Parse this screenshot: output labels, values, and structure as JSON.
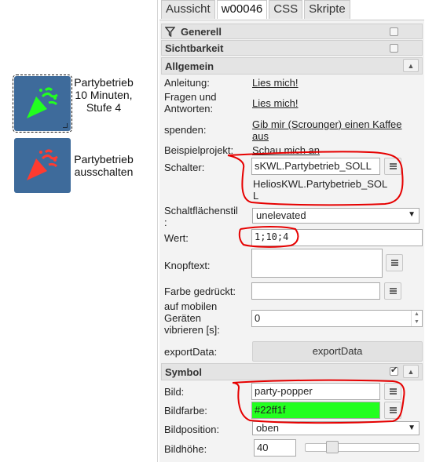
{
  "widgets": [
    {
      "label_lines": [
        "Partybetrieb",
        "10 Minuten,",
        "Stufe 4"
      ],
      "icon": "party-popper-icon",
      "icon_color": "#22ff1f",
      "selected": true
    },
    {
      "label_lines": [
        "Partybetrieb",
        "ausschalten"
      ],
      "icon": "party-popper-icon",
      "icon_color": "#ff3b30",
      "selected": false
    }
  ],
  "tabs": [
    "Aussicht",
    "w00046",
    "CSS",
    "Skripte"
  ],
  "groups": {
    "generell": "Generell",
    "sichtbarkeit": "Sichtbarkeit",
    "allgemein": "Allgemein",
    "symbol": "Symbol"
  },
  "fields": {
    "anleitung": {
      "label": "Anleitung:",
      "link": "Lies mich!"
    },
    "faq": {
      "label_lines": [
        "Fragen und",
        "Antworten:"
      ],
      "link": "Lies mich!"
    },
    "spenden": {
      "label": "spenden:",
      "link_lines": [
        "Gib mir (Scrounger) einen Kaffee",
        "aus"
      ]
    },
    "beispiel": {
      "label": "Beispielprojekt:",
      "link": "Schau mich an"
    },
    "schalter": {
      "label": "Schalter:",
      "value": "sKWL.Partybetrieb_SOLL",
      "oid_lines": [
        "HeliosKWL.Partybetrieb_SOL",
        "L"
      ]
    },
    "schaltflaechenstil": {
      "label_lines": [
        "Schaltflächenstil",
        ":"
      ],
      "value": "unelevated"
    },
    "wert": {
      "label": "Wert:",
      "value": "1;10;4"
    },
    "knopftext": {
      "label": "Knopftext:",
      "value": ""
    },
    "farbe_gedrueckt": {
      "label": "Farbe gedrückt:",
      "value": ""
    },
    "vibrieren": {
      "label_lines": [
        "auf mobilen",
        "Geräten",
        "vibrieren [s]:"
      ],
      "value": "0"
    },
    "exportdata": {
      "label": "exportData:",
      "button": "exportData"
    },
    "bild": {
      "label": "Bild:",
      "value": "party-popper"
    },
    "bildfarbe": {
      "label": "Bildfarbe:",
      "value": "#22ff1f",
      "color": "#22ff1f"
    },
    "bildposition": {
      "label": "Bildposition:",
      "value": "oben"
    },
    "bildhoehe": {
      "label": "Bildhöhe:",
      "value": "40",
      "slider_fraction": 0.2
    }
  },
  "colors": {
    "widget_bg": "#3e6b9b",
    "annotation": "#e60000"
  }
}
